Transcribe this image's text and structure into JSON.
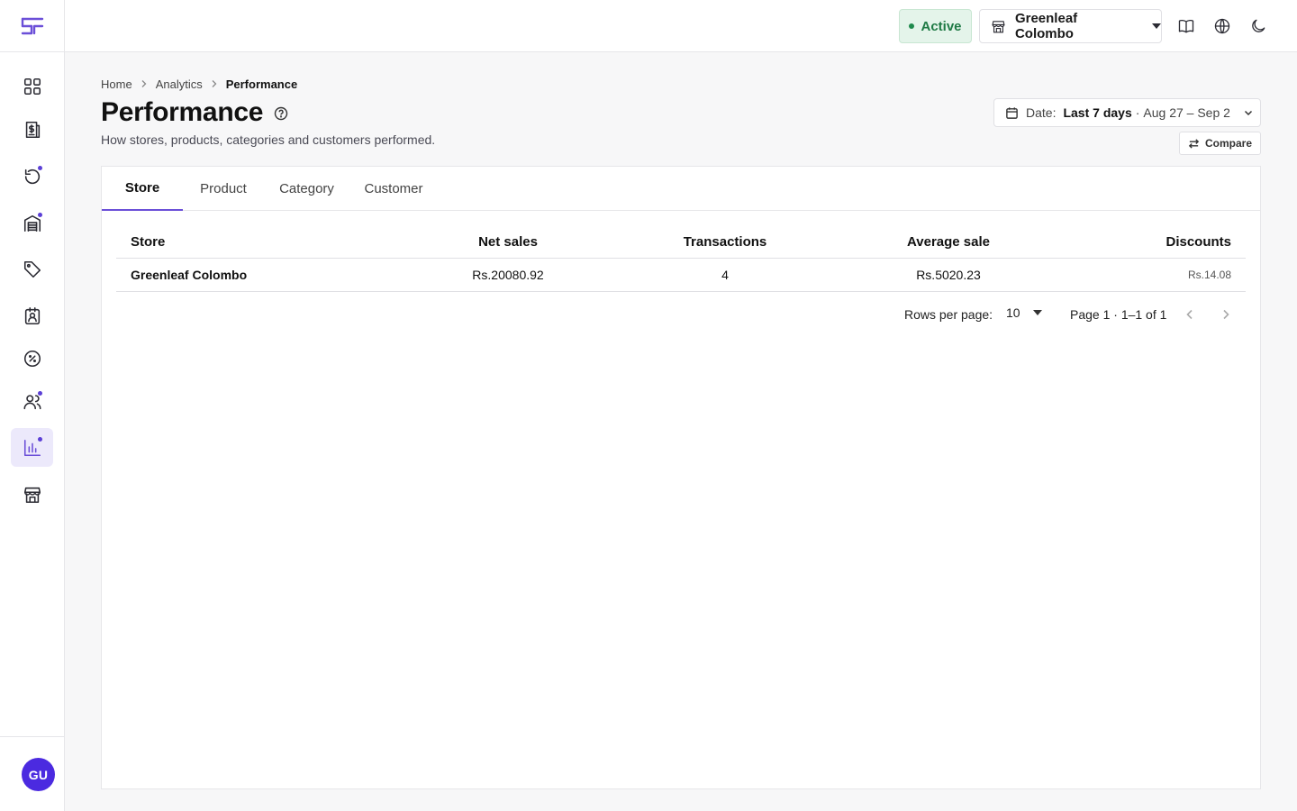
{
  "brand": {
    "logo_text": "SF",
    "accent": "#6b4fd8"
  },
  "sidebar": {
    "items": [
      {
        "name": "dashboard",
        "icon": "grid-icon",
        "active": false,
        "dot": false
      },
      {
        "name": "sales",
        "icon": "invoice-dollar-icon",
        "active": false,
        "dot": false
      },
      {
        "name": "returns",
        "icon": "rotate-icon",
        "active": false,
        "dot": true
      },
      {
        "name": "inventory",
        "icon": "warehouse-icon",
        "active": false,
        "dot": true
      },
      {
        "name": "products",
        "icon": "tag-icon",
        "active": false,
        "dot": false
      },
      {
        "name": "contacts",
        "icon": "contact-badge-icon",
        "active": false,
        "dot": false
      },
      {
        "name": "discounts",
        "icon": "percent-badge-icon",
        "active": false,
        "dot": false
      },
      {
        "name": "customers",
        "icon": "users-icon",
        "active": false,
        "dot": true
      },
      {
        "name": "analytics",
        "icon": "bar-chart-icon",
        "active": true,
        "dot": true
      },
      {
        "name": "stores",
        "icon": "storefront-icon",
        "active": false,
        "dot": false
      }
    ],
    "avatar_initials": "GU"
  },
  "topbar": {
    "status_label": "Active",
    "store_name": "Greenleaf Colombo"
  },
  "breadcrumb": {
    "home": "Home",
    "analytics": "Analytics",
    "current": "Performance"
  },
  "page": {
    "title": "Performance",
    "subtitle": "How stores, products, categories and customers performed."
  },
  "date_filter": {
    "prefix": "Date:",
    "range_label": "Last 7 days",
    "separator": "·",
    "range": "Aug 27 – Sep 2"
  },
  "compare_label": "Compare",
  "tabs": [
    "Store",
    "Product",
    "Category",
    "Customer"
  ],
  "table": {
    "headers": {
      "store": "Store",
      "net_sales": "Net sales",
      "transactions": "Transactions",
      "average_sale": "Average sale",
      "discounts": "Discounts"
    },
    "rows": [
      {
        "store": "Greenleaf Colombo",
        "net_sales": "Rs.20080.92",
        "transactions": "4",
        "average_sale": "Rs.5020.23",
        "discounts": "Rs.14.08"
      }
    ]
  },
  "pagination": {
    "rows_per_page_label": "Rows per page:",
    "rows_per_page": "10",
    "page_info": "Page 1 · 1–1 of 1"
  }
}
